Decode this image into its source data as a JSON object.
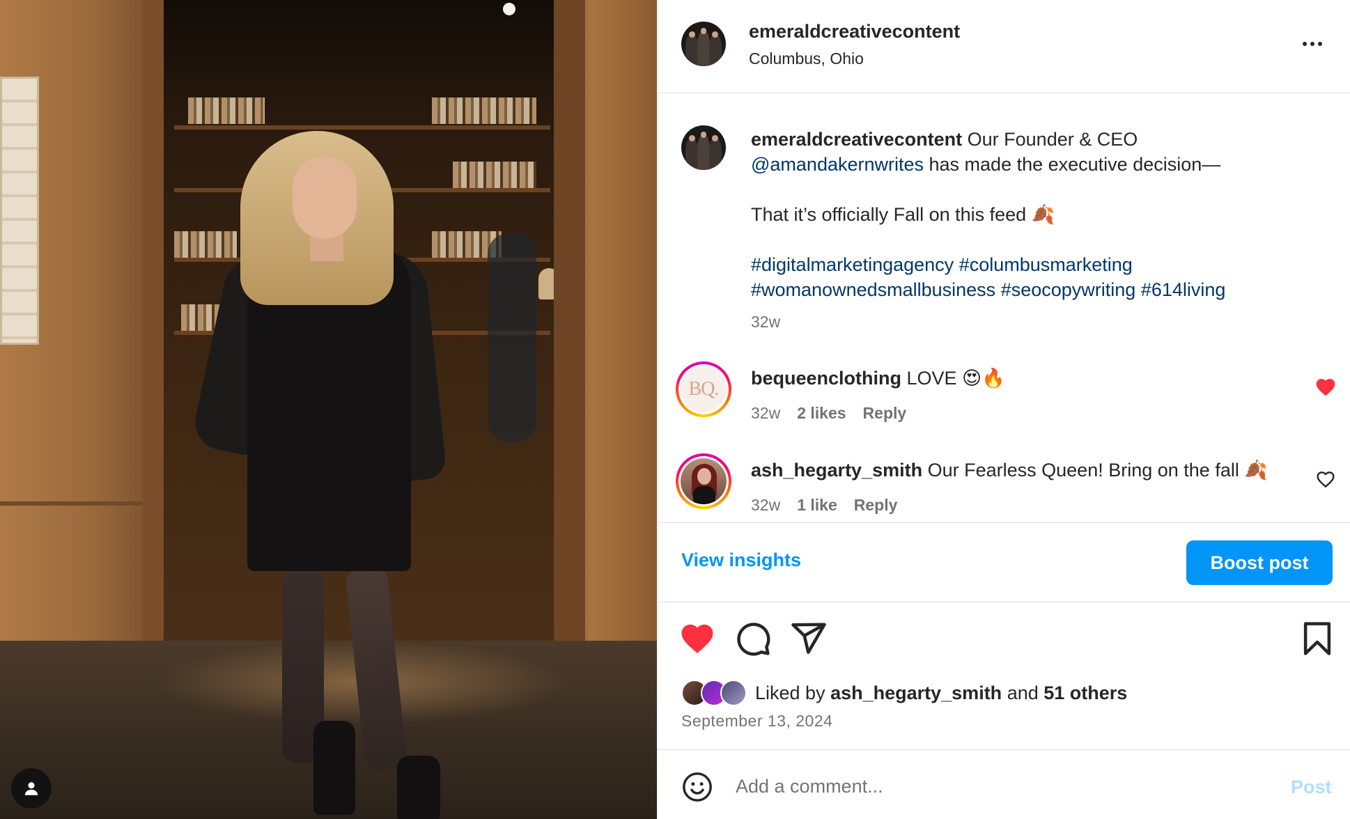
{
  "post": {
    "username": "emeraldcreativecontent",
    "location": "Columbus, Ohio"
  },
  "caption": {
    "username": "emeraldcreativecontent",
    "text_intro": " Our Founder & CEO",
    "mention": "@amandakernwrites",
    "text_after_mention": " has made the executive decision—",
    "line2": "That it’s officially Fall on this feed 🍂",
    "hashtags_line1": [
      "#digitalmarketingagency",
      "#columbusmarketing"
    ],
    "hashtags_line2": [
      "#womanownedsmallbusiness",
      "#seocopywriting",
      "#614living"
    ],
    "time": "32w"
  },
  "comments": [
    {
      "username": "bequeenclothing",
      "avatar_text": "BQ.",
      "text": " LOVE 😍🔥",
      "time": "32w",
      "likes": "2 likes",
      "reply_label": "Reply",
      "liked": true
    },
    {
      "username": "ash_hegarty_smith",
      "text": " Our Fearless Queen! Bring on the fall 🍂",
      "time": "32w",
      "likes": "1 like",
      "reply_label": "Reply",
      "liked": false
    }
  ],
  "insights": {
    "view_label": "View insights",
    "boost_label": "Boost post"
  },
  "likes": {
    "prefix": "Liked by ",
    "user": "ash_hegarty_smith",
    "middle": " and ",
    "others": "51 others"
  },
  "date": "September 13, 2024",
  "comment_box": {
    "placeholder": "Add a comment...",
    "post_label": "Post"
  },
  "colors": {
    "accent": "#0095f6",
    "like_red": "#ff3040",
    "link": "#00376b",
    "muted": "#737373"
  },
  "icons": {
    "photo_user_tag": "user-tag-icon",
    "more": "more-options-icon",
    "like": "heart-filled-icon",
    "comment": "comment-icon",
    "share": "share-icon",
    "save": "bookmark-icon",
    "emoji": "emoji-icon"
  }
}
